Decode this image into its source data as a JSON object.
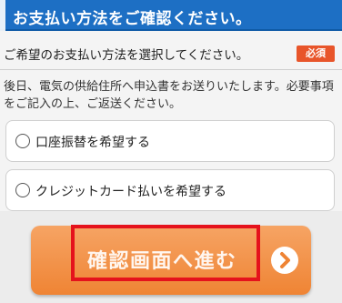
{
  "header": {
    "title": "お支払い方法をご確認ください。"
  },
  "instruction": {
    "text": "ご希望のお支払い方法を選択してください。",
    "required_badge": "必須"
  },
  "note": {
    "text": "後日、電気の供給住所へ申込書をお送りいたします。必要事項をご記入の上、ご返送ください。"
  },
  "options": [
    {
      "label": "口座振替を希望する",
      "selected": false
    },
    {
      "label": "クレジットカード払いを希望する",
      "selected": false
    }
  ],
  "proceed_button": {
    "label": "確認画面へ進む",
    "icon": "chevron-right-circle-icon"
  },
  "colors": {
    "header_bg": "#1d6fc4",
    "badge_bg": "#e8552a",
    "button_bg": "#ef8434",
    "highlight": "#e5121c"
  }
}
